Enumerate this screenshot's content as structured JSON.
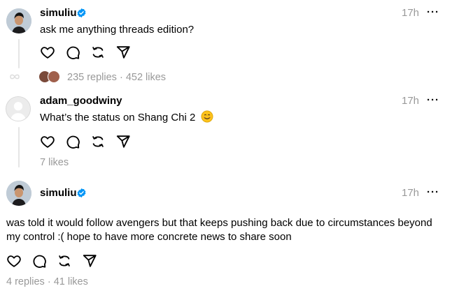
{
  "posts": [
    {
      "username": "simuliu",
      "verified": true,
      "time": "17h",
      "more": "···",
      "text": "ask me anything threads edition?",
      "stats": "235 replies · 452 likes"
    },
    {
      "username": "adam_goodwiny",
      "verified": false,
      "time": "17h",
      "more": "···",
      "text": "What’s the status on Shang Chi 2",
      "stats": "7 likes"
    },
    {
      "username": "simuliu",
      "verified": true,
      "time": "17h",
      "more": "···",
      "text_line1": "was told it would follow avengers but that keeps pushing back due to circumstances beyond",
      "text_line2": "my control :( hope to have more concrete news to share soon",
      "stats": "4 replies · 41 likes"
    }
  ],
  "icons": [
    "like-icon",
    "reply-icon",
    "repost-icon",
    "share-icon",
    "verified-icon",
    "more-icon",
    "smile-emoji-icon"
  ],
  "colors": {
    "verified": "#0095f6",
    "muted": "#999999",
    "thread_line": "#e5e5e5"
  }
}
